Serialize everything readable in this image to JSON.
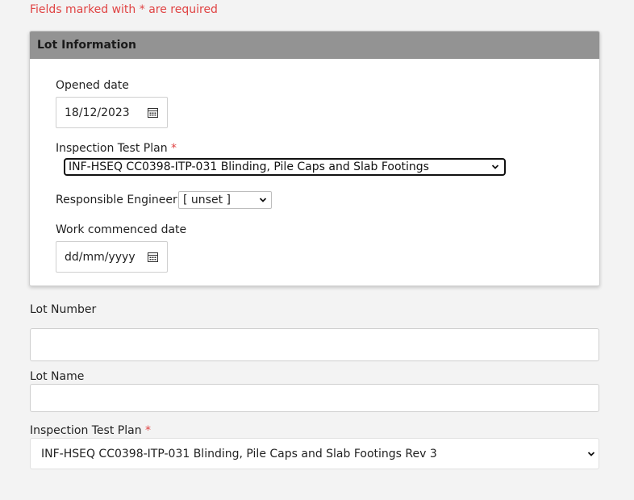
{
  "form": {
    "required_note": "Fields marked with * are required",
    "required_marker": "*"
  },
  "lot_info": {
    "title": "Lot Information",
    "opened_date": {
      "label": "Opened date",
      "value": "18/12/2023"
    },
    "inspection_test_plan": {
      "label": "Inspection Test Plan",
      "value": "INF-HSEQ CC0398-ITP-031 Blinding, Pile Caps and Slab Footings"
    },
    "responsible_engineer": {
      "label": "Responsible Engineer",
      "value": "[ unset ]"
    },
    "work_commenced_date": {
      "label": "Work commenced date",
      "placeholder": "dd/mm/yyyy"
    }
  },
  "lot_number": {
    "label": "Lot Number",
    "value": ""
  },
  "lot_name": {
    "label": "Lot Name",
    "value": ""
  },
  "inspection_test_plan": {
    "label": "Inspection Test Plan",
    "value": "INF-HSEQ CC0398-ITP-031 Blinding, Pile Caps and Slab Footings Rev 3"
  },
  "icons": {
    "calendar": "calendar-icon",
    "chevron": "chevron-down-icon"
  },
  "colors": {
    "required": "#e04444",
    "panel_header": "#939393"
  }
}
